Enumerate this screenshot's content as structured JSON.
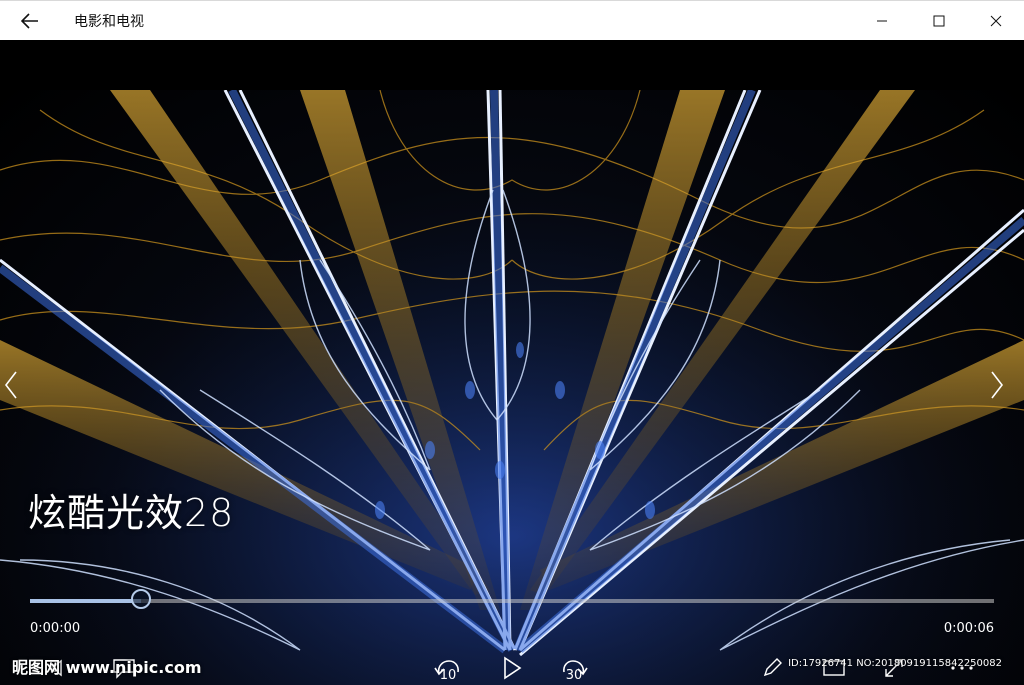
{
  "app": {
    "title": "电影和电视"
  },
  "player": {
    "media_title": "炫酷光效28",
    "elapsed": "0:00:00",
    "total": "0:00:06",
    "progress_fraction": 0.115,
    "skip_back_seconds": "10",
    "skip_forward_seconds": "30"
  },
  "watermark": {
    "site": "昵图网 www.nipic.com",
    "id_text": "ID:17926741 NO:20180919115842250082"
  },
  "icons": {
    "back": "back-arrow-icon",
    "minimize": "minimize-icon",
    "maximize": "maximize-icon",
    "close": "close-icon",
    "prev": "chevron-left-icon",
    "next": "chevron-right-icon"
  },
  "colors": {
    "seek_fill": "#a9c2e6",
    "gold": "#d9a227",
    "blue": "#3c6fe0"
  }
}
